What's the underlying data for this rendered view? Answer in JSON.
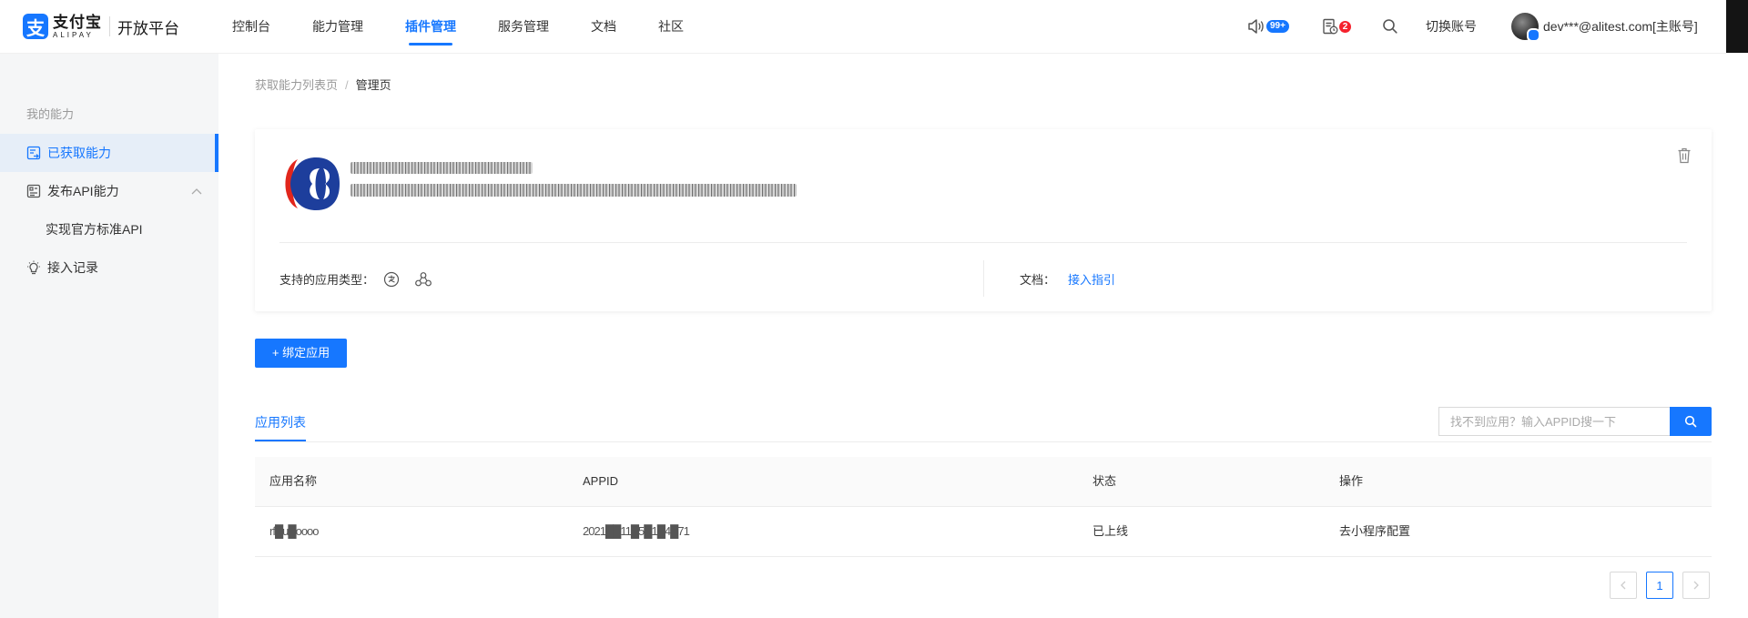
{
  "brand": {
    "cn": "支付宝",
    "en": "ALIPAY",
    "platform": "开放平台",
    "mark": "支"
  },
  "nav": [
    {
      "label": "控制台"
    },
    {
      "label": "能力管理"
    },
    {
      "label": "插件管理"
    },
    {
      "label": "服务管理"
    },
    {
      "label": "文档"
    },
    {
      "label": "社区"
    }
  ],
  "nav_active": "插件管理",
  "topbar": {
    "notice_badge": "99+",
    "todo_badge": "2",
    "switch_account": "切换账号",
    "user": "dev***@alitest.com[主账号]"
  },
  "sidebar": {
    "section_title": "我的能力",
    "items": [
      {
        "label": "已获取能力",
        "icon": "list-icon",
        "active": true
      },
      {
        "label": "发布API能力",
        "icon": "api-icon",
        "active": false
      },
      {
        "label": "实现官方标准API",
        "sub": true
      },
      {
        "label": "接入记录",
        "icon": "bulb-icon",
        "active": false
      }
    ]
  },
  "breadcrumb": {
    "parent": "获取能力列表页",
    "separator": "/",
    "current": "管理页"
  },
  "card": {
    "app_types_label": "支持的应用类型：",
    "app_type_icons": [
      "alipay-app-icon",
      "mini-program-icon"
    ],
    "doc_label": "文档：",
    "doc_link": "接入指引"
  },
  "bind_button": "+ 绑定应用",
  "tab": "应用列表",
  "search": {
    "placeholder": "找不到应用？输入APPID搜一下",
    "value": ""
  },
  "table": {
    "columns": [
      "应用名称",
      "APPID",
      "状态",
      "操作"
    ],
    "rows": [
      {
        "name": "rf█u█oooo",
        "appid": "2021██11█5█1█4█71",
        "status": "已上线",
        "action": "去小程序配置"
      }
    ]
  },
  "pagination": {
    "current": "1"
  },
  "colors": {
    "primary": "#1677ff",
    "badge_red": "#f5222d",
    "sidebar_bg": "#f5f6f7"
  }
}
